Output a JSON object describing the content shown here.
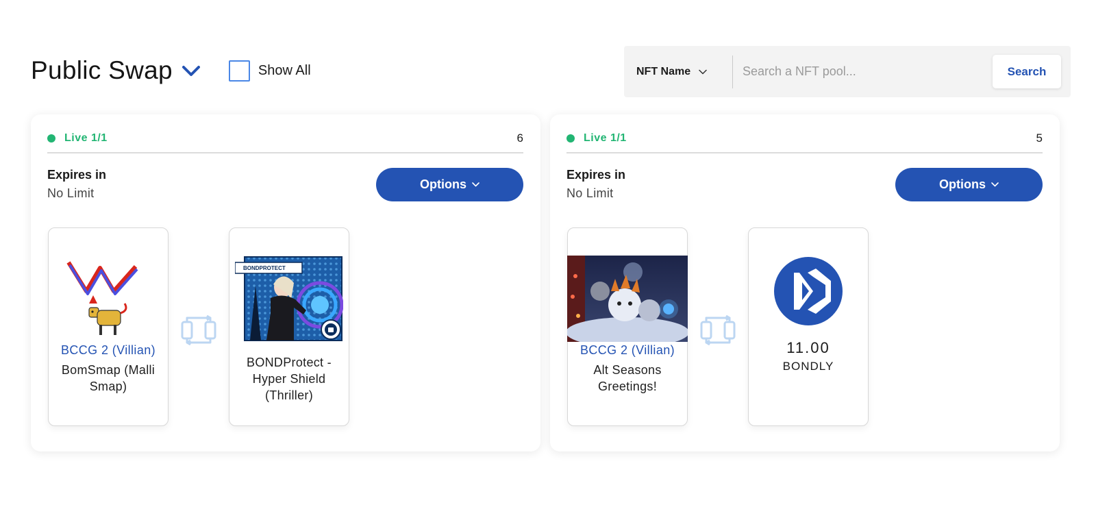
{
  "header": {
    "title": "Public Swap",
    "title_dropdown_icon": "chevron-down-icon",
    "show_all": {
      "label": "Show All",
      "checked": false
    }
  },
  "search": {
    "filter_label": "NFT Name",
    "placeholder": "Search a NFT pool...",
    "button_label": "Search"
  },
  "colors": {
    "primary": "#2453b3",
    "live": "#22b573",
    "checkbox_border": "#4a87e6"
  },
  "pools": [
    {
      "status": "Live 1/1",
      "count": "6",
      "expires_label": "Expires in",
      "expires_value": "No Limit",
      "options_label": "Options",
      "offer": {
        "collection": "BCCG 2 (Villian)",
        "name": "BomSmap (Malli Smap)"
      },
      "request": {
        "name": "BONDProtect - Hyper Shield (Thriller)",
        "badge": "BONDPROTECT"
      }
    },
    {
      "status": "Live 1/1",
      "count": "5",
      "expires_label": "Expires in",
      "expires_value": "No Limit",
      "options_label": "Options",
      "offer": {
        "collection": "BCCG 2 (Villian)",
        "name": "Alt Seasons Greetings!"
      },
      "request": {
        "amount": "11.00",
        "symbol": "BONDLY"
      }
    }
  ]
}
